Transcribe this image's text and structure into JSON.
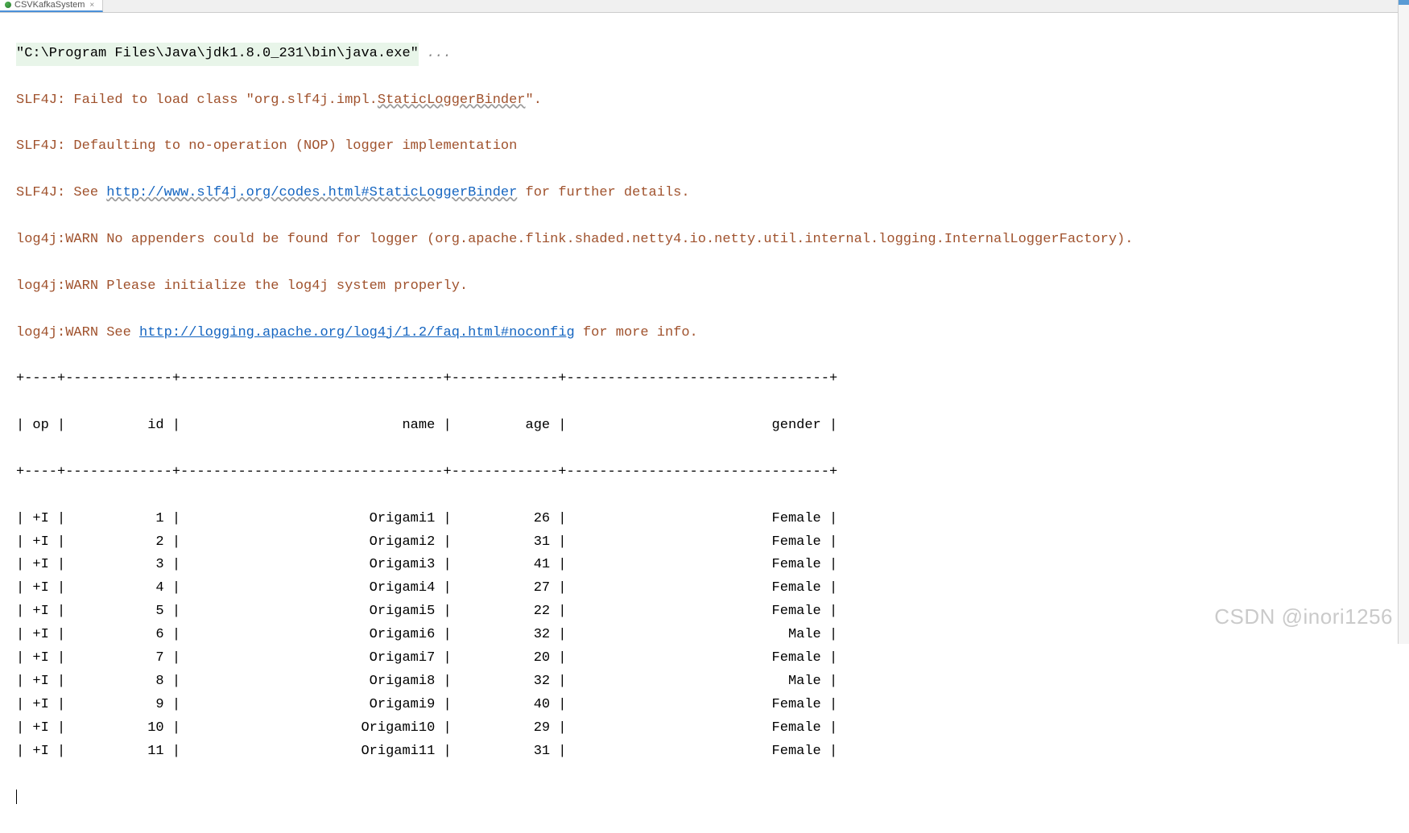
{
  "tab": {
    "title": "CSVKafkaSystem",
    "close_glyph": "×"
  },
  "command": {
    "path": "\"C:\\Program Files\\Java\\jdk1.8.0_231\\bin\\java.exe\"",
    "rest": " ..."
  },
  "log": {
    "slf4j1_prefix": "SLF4J: Failed to load class \"org.slf4j.impl.",
    "slf4j1_class": "StaticLoggerBinder",
    "slf4j1_suffix": "\".",
    "slf4j2": "SLF4J: Defaulting to no-operation (NOP) logger implementation",
    "slf4j3_prefix": "SLF4J: See ",
    "slf4j3_link": "http://www.slf4j.org/codes.html#StaticLoggerBinder",
    "slf4j3_suffix": " for further details.",
    "log4j1": "log4j:WARN No appenders could be found for logger (org.apache.flink.shaded.netty4.io.netty.util.internal.logging.InternalLoggerFactory).",
    "log4j2": "log4j:WARN Please initialize the log4j system properly.",
    "log4j3_prefix": "log4j:WARN See ",
    "log4j3_link": "http://logging.apache.org/log4j/1.2/faq.html#noconfig",
    "log4j3_suffix": " for more info."
  },
  "table": {
    "border_top": "+----+-------------+--------------------------------+-------------+--------------------------------+",
    "header": "| op |          id |                           name |         age |                         gender |",
    "border_mid": "+----+-------------+--------------------------------+-------------+--------------------------------+",
    "columns": [
      "op",
      "id",
      "name",
      "age",
      "gender"
    ],
    "rows": [
      {
        "op": "+I",
        "id": 1,
        "name": "Origami1",
        "age": 26,
        "gender": "Female"
      },
      {
        "op": "+I",
        "id": 2,
        "name": "Origami2",
        "age": 31,
        "gender": "Female"
      },
      {
        "op": "+I",
        "id": 3,
        "name": "Origami3",
        "age": 41,
        "gender": "Female"
      },
      {
        "op": "+I",
        "id": 4,
        "name": "Origami4",
        "age": 27,
        "gender": "Female"
      },
      {
        "op": "+I",
        "id": 5,
        "name": "Origami5",
        "age": 22,
        "gender": "Female"
      },
      {
        "op": "+I",
        "id": 6,
        "name": "Origami6",
        "age": 32,
        "gender": "Male"
      },
      {
        "op": "+I",
        "id": 7,
        "name": "Origami7",
        "age": 20,
        "gender": "Female"
      },
      {
        "op": "+I",
        "id": 8,
        "name": "Origami8",
        "age": 32,
        "gender": "Male"
      },
      {
        "op": "+I",
        "id": 9,
        "name": "Origami9",
        "age": 40,
        "gender": "Female"
      },
      {
        "op": "+I",
        "id": 10,
        "name": "Origami10",
        "age": 29,
        "gender": "Female"
      },
      {
        "op": "+I",
        "id": 11,
        "name": "Origami11",
        "age": 31,
        "gender": "Female"
      }
    ],
    "col_widths": {
      "op": 4,
      "id": 13,
      "name": 32,
      "age": 13,
      "gender": 32
    }
  },
  "watermark": "CSDN @inori1256"
}
